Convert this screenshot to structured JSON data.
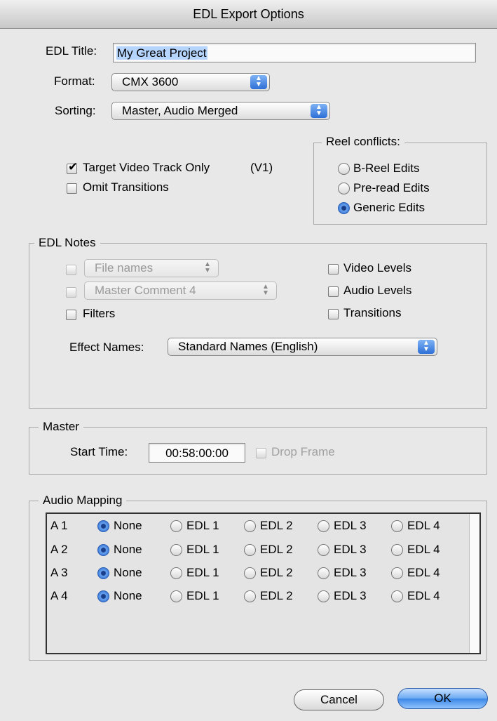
{
  "window": {
    "title": "EDL Export Options"
  },
  "edl_title": {
    "label": "EDL Title:",
    "value": "My Great Project"
  },
  "format": {
    "label": "Format:",
    "value": "CMX 3600"
  },
  "sorting": {
    "label": "Sorting:",
    "value": "Master, Audio Merged"
  },
  "options": {
    "target_video": {
      "label": "Target Video Track Only",
      "suffix": "(V1)",
      "checked": true
    },
    "omit_transitions": {
      "label": "Omit Transitions",
      "checked": false
    }
  },
  "reel_conflicts": {
    "title": "Reel conflicts:",
    "options": [
      {
        "label": "B-Reel Edits",
        "selected": false
      },
      {
        "label": "Pre-read Edits",
        "selected": false
      },
      {
        "label": "Generic Edits",
        "selected": true
      }
    ]
  },
  "edl_notes": {
    "title": "EDL Notes",
    "file_names": {
      "value": "File names",
      "checked": false,
      "enabled": false
    },
    "master_comment": {
      "value": "Master Comment 4",
      "checked": false,
      "enabled": false
    },
    "filters": {
      "label": "Filters",
      "checked": false
    },
    "video_levels": {
      "label": "Video Levels",
      "checked": false
    },
    "audio_levels": {
      "label": "Audio Levels",
      "checked": false
    },
    "transitions": {
      "label": "Transitions",
      "checked": false
    },
    "effect_names": {
      "label": "Effect Names:",
      "value": "Standard Names (English)"
    }
  },
  "master": {
    "title": "Master",
    "start_time_label": "Start Time:",
    "start_time_value": "00:58:00:00",
    "drop_frame": {
      "label": "Drop Frame",
      "checked": false,
      "enabled": false
    }
  },
  "audio_mapping": {
    "title": "Audio Mapping",
    "columns": [
      "None",
      "EDL 1",
      "EDL 2",
      "EDL 3",
      "EDL 4"
    ],
    "rows": [
      {
        "track": "A 1",
        "selected": "None"
      },
      {
        "track": "A 2",
        "selected": "None"
      },
      {
        "track": "A 3",
        "selected": "None"
      },
      {
        "track": "A 4",
        "selected": "None"
      }
    ]
  },
  "buttons": {
    "cancel": "Cancel",
    "ok": "OK"
  }
}
